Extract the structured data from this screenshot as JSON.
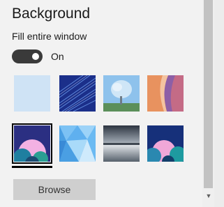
{
  "section": {
    "title": "Background",
    "subtitle": "Fill entire window"
  },
  "toggle": {
    "state_label": "On",
    "on": true
  },
  "backgrounds": [
    {
      "name": "solid-light-blue",
      "selected": false
    },
    {
      "name": "blue-light-streaks",
      "selected": false
    },
    {
      "name": "tree-under-blue-sky",
      "selected": false
    },
    {
      "name": "canyon-rock",
      "selected": false
    },
    {
      "name": "bubbles-dark-blue",
      "selected": true
    },
    {
      "name": "blue-low-poly",
      "selected": false
    },
    {
      "name": "misty-lake",
      "selected": false
    },
    {
      "name": "bubbles-navy",
      "selected": false
    }
  ],
  "browse": {
    "label": "Browse"
  },
  "colors": {
    "toggle_on": "#3a3a3a",
    "selection": "#000000",
    "button": "#cfcfcf"
  }
}
